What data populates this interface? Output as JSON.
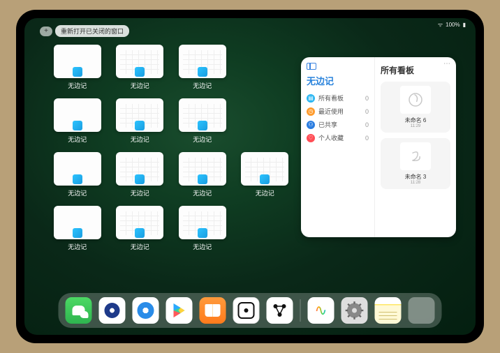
{
  "status": {
    "battery": "100%",
    "signal": "●●●●"
  },
  "top": {
    "plus": "+",
    "reopen_label": "重新打开已关闭的窗口"
  },
  "app_label": "无边记",
  "panel": {
    "left_title": "无边记",
    "items": [
      {
        "color": "#2ab6f2",
        "label": "所有看板",
        "count": "0"
      },
      {
        "color": "#ff9c2e",
        "label": "最近使用",
        "count": "0"
      },
      {
        "color": "#2b7de0",
        "label": "已共享",
        "count": "0"
      },
      {
        "color": "#ff4d55",
        "label": "个人收藏",
        "count": "0"
      }
    ],
    "right_title": "所有看板",
    "boards": [
      {
        "name": "未命名 6",
        "time": "11:29"
      },
      {
        "name": "未命名 3",
        "time": "11:28"
      }
    ]
  },
  "dock_icons": [
    "wechat-icon",
    "quark-blue-icon",
    "quark-icon",
    "play-store-icon",
    "books-icon",
    "dice-icon",
    "graph-icon",
    "freeform-icon",
    "settings-icon",
    "notes-icon",
    "app-cluster-icon"
  ]
}
